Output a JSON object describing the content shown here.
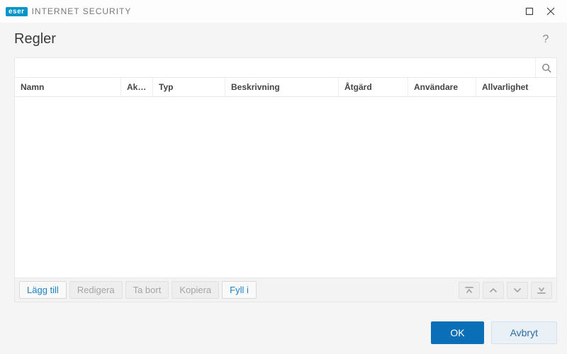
{
  "titlebar": {
    "brand": "eser",
    "product": "INTERNET SECURITY"
  },
  "header": {
    "title": "Regler",
    "help": "?"
  },
  "search": {
    "value": "",
    "placeholder": ""
  },
  "columns": {
    "namn": "Namn",
    "aktiv": "Aktiv...",
    "typ": "Typ",
    "besk": "Beskrivning",
    "atgard": "Åtgärd",
    "anvand": "Användare",
    "allv": "Allvarlighet"
  },
  "rows": [],
  "toolbar": {
    "add": "Lägg till",
    "edit": "Redigera",
    "delete": "Ta bort",
    "copy": "Kopiera",
    "fill": "Fyll i"
  },
  "buttons": {
    "ok": "OK",
    "cancel": "Avbryt"
  }
}
